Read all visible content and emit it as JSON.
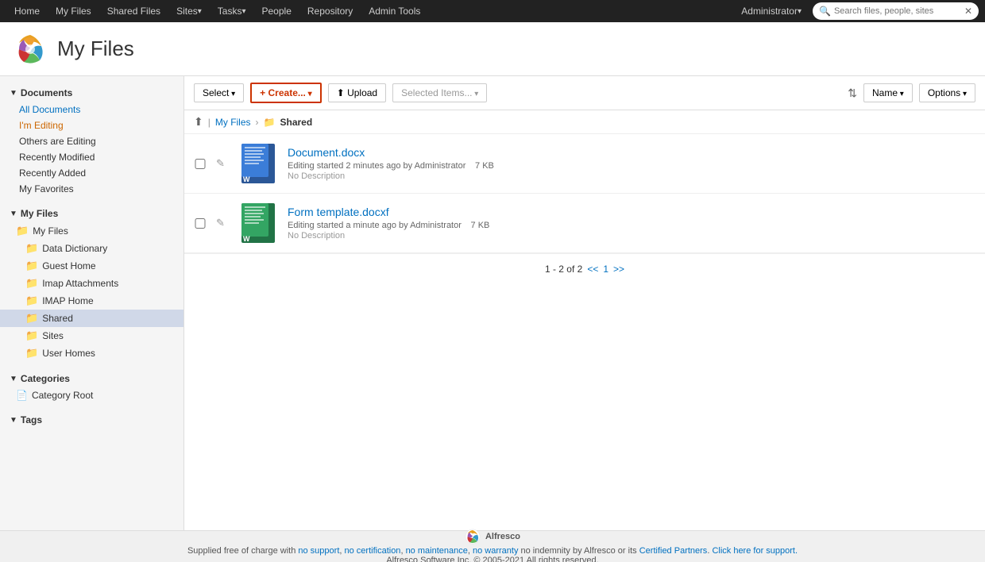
{
  "nav": {
    "items": [
      {
        "label": "Home",
        "active": false
      },
      {
        "label": "My Files",
        "active": false
      },
      {
        "label": "Shared Files",
        "active": false
      },
      {
        "label": "Sites",
        "active": false,
        "hasArrow": true
      },
      {
        "label": "Tasks",
        "active": false,
        "hasArrow": true
      },
      {
        "label": "People",
        "active": false
      },
      {
        "label": "Repository",
        "active": false
      },
      {
        "label": "Admin Tools",
        "active": false
      }
    ],
    "user": "Administrator",
    "search_placeholder": "Search files, people, sites"
  },
  "header": {
    "title": "My Files",
    "logo_alt": "Alfresco"
  },
  "toolbar": {
    "select_label": "Select",
    "create_label": "Create...",
    "upload_label": "Upload",
    "selected_label": "Selected Items...",
    "name_label": "Name",
    "options_label": "Options"
  },
  "breadcrumb": {
    "home_title": "Home",
    "my_files": "My Files",
    "current": "Shared"
  },
  "sidebar": {
    "documents_section": "Documents",
    "documents_items": [
      {
        "label": "All Documents",
        "style": "link"
      },
      {
        "label": "I'm Editing",
        "style": "editing"
      },
      {
        "label": "Others are Editing",
        "style": "normal"
      },
      {
        "label": "Recently Modified",
        "style": "normal"
      },
      {
        "label": "Recently Added",
        "style": "normal"
      },
      {
        "label": "My Favorites",
        "style": "normal"
      }
    ],
    "myfiles_section": "My Files",
    "myfiles_root": "My Files",
    "myfiles_items": [
      {
        "label": "Data Dictionary"
      },
      {
        "label": "Guest Home"
      },
      {
        "label": "Imap Attachments"
      },
      {
        "label": "IMAP Home"
      },
      {
        "label": "Shared",
        "active": true
      },
      {
        "label": "Sites"
      },
      {
        "label": "User Homes"
      }
    ],
    "categories_section": "Categories",
    "categories_items": [
      {
        "label": "Category Root"
      }
    ],
    "tags_section": "Tags"
  },
  "files": [
    {
      "name": "Document.docx",
      "meta": "Editing started 2 minutes ago by Administrator",
      "size": "7 KB",
      "description": "No Description",
      "type": "docx"
    },
    {
      "name": "Form template.docxf",
      "meta": "Editing started a minute ago by Administrator",
      "size": "7 KB",
      "description": "No Description",
      "type": "docxf"
    }
  ],
  "pagination": {
    "range": "1 - 2 of 2",
    "prev": "<<",
    "page": "1",
    "next": ">>"
  },
  "footer": {
    "supplied_text": "Supplied free of charge with",
    "no_support": "no support",
    "no_cert": "no certification",
    "no_maint": "no maintenance",
    "no_warranty": "no warranty",
    "no_indemnity": "no indemnity",
    "by_alfresco": "by Alfresco or its",
    "certified_partners": "Certified Partners",
    "click_support": "Click here for support.",
    "copyright": "Alfresco Software Inc. © 2005-2021 All rights reserved."
  }
}
